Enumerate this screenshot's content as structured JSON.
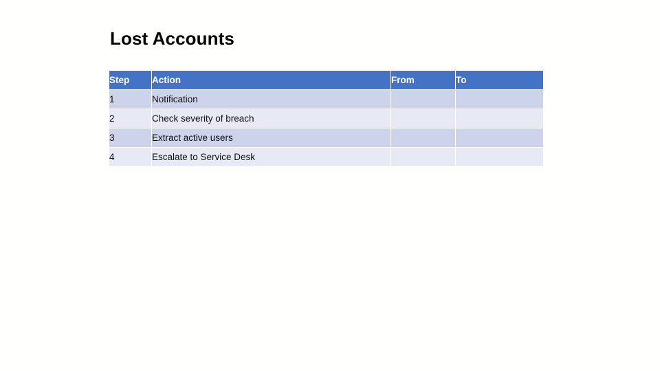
{
  "slide": {
    "title": "Lost Accounts",
    "background_color": "#fffffd"
  },
  "theme": {
    "header_background": "#4472c4",
    "header_text_color": "#ffffff",
    "row_odd_background": "#ccd3ea",
    "row_even_background": "#e7eaf4",
    "body_text_color": "#101010",
    "title_text_color": "#000000"
  },
  "table": {
    "columns": [
      {
        "key": "step",
        "label": "Step"
      },
      {
        "key": "action",
        "label": "Action"
      },
      {
        "key": "from",
        "label": "From"
      },
      {
        "key": "to",
        "label": "To"
      }
    ],
    "rows": [
      {
        "step": "1",
        "action": "Notification",
        "from": "",
        "to": ""
      },
      {
        "step": "2",
        "action": "Check severity of breach",
        "from": "",
        "to": ""
      },
      {
        "step": "3",
        "action": "Extract active users",
        "from": "",
        "to": ""
      },
      {
        "step": "4",
        "action": "Escalate to Service Desk",
        "from": "",
        "to": ""
      }
    ]
  }
}
